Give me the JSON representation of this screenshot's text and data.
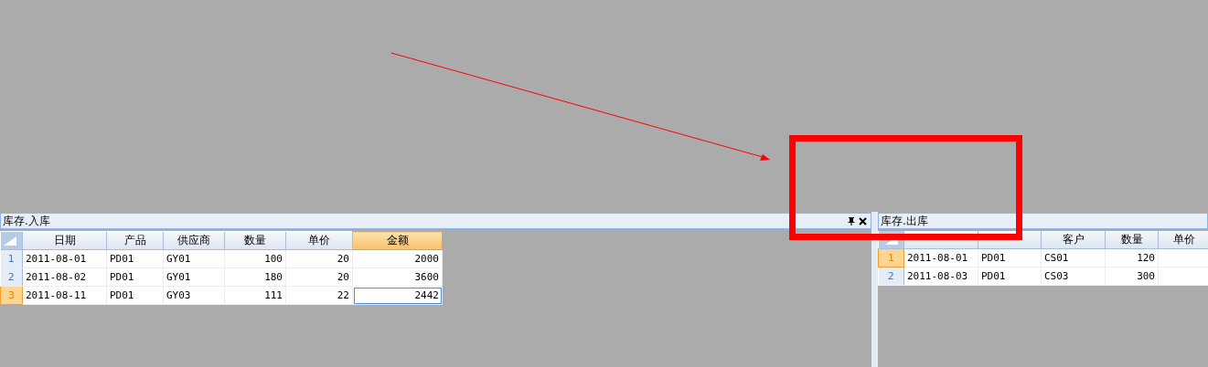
{
  "panels": [
    {
      "title": "库存.入库",
      "buttons": [
        {
          "kind": "pin"
        },
        {
          "kind": "close"
        }
      ],
      "columns": [
        {
          "label": "日期",
          "selected": false
        },
        {
          "label": "产品",
          "selected": false
        },
        {
          "label": "供应商",
          "selected": false
        },
        {
          "label": "数量",
          "selected": false
        },
        {
          "label": "单价",
          "selected": false
        },
        {
          "label": "金额",
          "selected": true
        }
      ],
      "rows": [
        {
          "number": "1",
          "selected": false,
          "cells": [
            {
              "text": "2011-08-01",
              "focused": false
            },
            {
              "text": "PD01",
              "focused": false
            },
            {
              "text": "GY01",
              "focused": false
            },
            {
              "text": "100",
              "focused": false
            },
            {
              "text": "20",
              "focused": false
            },
            {
              "text": "2000",
              "focused": false
            }
          ]
        },
        {
          "number": "2",
          "selected": false,
          "cells": [
            {
              "text": "2011-08-02",
              "focused": false
            },
            {
              "text": "PD01",
              "focused": false
            },
            {
              "text": "GY01",
              "focused": false
            },
            {
              "text": "180",
              "focused": false
            },
            {
              "text": "20",
              "focused": false
            },
            {
              "text": "3600",
              "focused": false
            }
          ]
        },
        {
          "number": "3",
          "selected": true,
          "cells": [
            {
              "text": "2011-08-11",
              "focused": false
            },
            {
              "text": "PD01",
              "focused": false
            },
            {
              "text": "GY03",
              "focused": false
            },
            {
              "text": "111",
              "focused": false
            },
            {
              "text": "22",
              "focused": false
            },
            {
              "text": "2442",
              "focused": true
            }
          ]
        }
      ]
    },
    {
      "title": "库存.出库",
      "columns": [
        {
          "selected": false
        },
        {
          "selected": false
        },
        {
          "label": "客户",
          "selected": false
        },
        {
          "label": "数量",
          "selected": false
        },
        {
          "label": "单价",
          "selected": false
        }
      ],
      "rows": [
        {
          "number": "1",
          "selected": true,
          "cells": [
            {
              "text": "2011-08-01",
              "focused": false
            },
            {
              "text": "PD01",
              "focused": false
            },
            {
              "text": "CS01",
              "focused": false
            },
            {
              "text": "120",
              "focused": false
            }
          ]
        },
        {
          "number": "2",
          "selected": false,
          "cells": [
            {
              "text": "2011-08-03",
              "focused": false
            },
            {
              "text": "PD01",
              "focused": false
            },
            {
              "text": "CS03",
              "focused": false
            },
            {
              "text": "300",
              "focused": false
            }
          ]
        }
      ]
    }
  ]
}
